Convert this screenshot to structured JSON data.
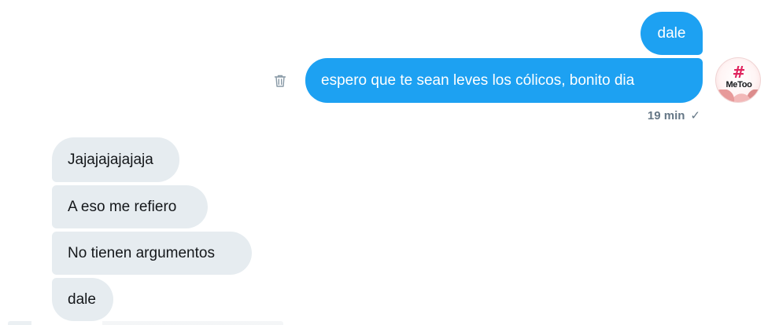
{
  "sent_messages": [
    {
      "text": "dale"
    },
    {
      "text": "espero que te sean leves los cólicos, bonito dia"
    }
  ],
  "sent_meta": {
    "time": "19 min",
    "status_icon": "check-icon",
    "status_glyph": "✓"
  },
  "avatar": {
    "hashtag": "#",
    "tag_text": "MeToo"
  },
  "received_messages": [
    {
      "text": "Jajajajajajaja"
    },
    {
      "text": "A eso me refiero"
    },
    {
      "text": "No tienen argumentos"
    },
    {
      "text": "dale"
    }
  ],
  "icons": {
    "delete": "trash-icon"
  },
  "colors": {
    "sent_bubble": "#1da1f2",
    "received_bubble": "#e6ecf0",
    "meta_text": "#657786"
  }
}
